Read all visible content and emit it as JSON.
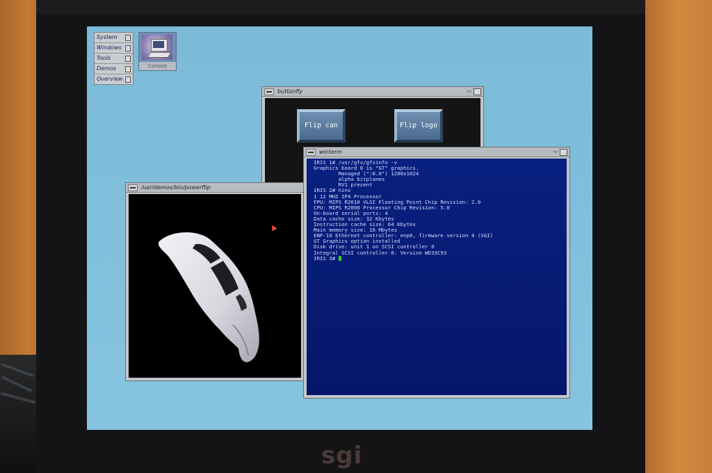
{
  "brand": {
    "logo_text": "sgi"
  },
  "toolchest": {
    "items": [
      {
        "label": "System"
      },
      {
        "label": "Windows"
      },
      {
        "label": "Tools"
      },
      {
        "label": "Demos"
      },
      {
        "label": "Overview"
      }
    ]
  },
  "desktop_icons": [
    {
      "label": "Console",
      "icon": "console-workstation-icon"
    }
  ],
  "windows": {
    "buttonfly": {
      "title": "buttonfly",
      "buttons": [
        {
          "label": "Flip can"
        },
        {
          "label": "Flip logo"
        }
      ]
    },
    "powerflip": {
      "title": "/usr/demos/bin/powerflip"
    },
    "winterm": {
      "title": "winterm",
      "lines": [
        "IRIS 1# /usr/gfx/gfxinfo -v",
        "Graphics board 0 is \"GT\" graphics.",
        "        Managed (\":0.0\") 1280x1024",
        "        alpha bitplanes",
        "        RV1 present",
        "IRIS 2# hinv",
        "1 12 MHZ IP4 Processor",
        "FPU: MIPS R2010 VLSI Floating Point Chip Revision: 2.0",
        "CPU: MIPS R2000 Processor Chip Revision: 5.0",
        "On-board serial ports: 4",
        "Data cache size: 32 Kbytes",
        "Instruction cache size: 64 Kbytes",
        "Main memory size: 16 Mbytes",
        "ENP-10 Ethernet controller: enp0, firmware version 4 (SGI)",
        "GT Graphics option installed",
        "Disk drive: unit 1 on SCSI controller 0",
        "Integral SCSI controller 0: Version WD33C93"
      ],
      "prompt": "IRIS 3# "
    }
  },
  "colors": {
    "desktop": "#80c0dc",
    "terminal_bg": "#082080",
    "terminal_fg": "#d9dcff",
    "cursor": "#2fd12f"
  }
}
